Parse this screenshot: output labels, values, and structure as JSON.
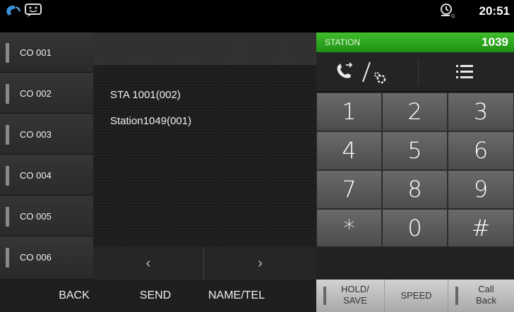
{
  "status_bar": {
    "time": "20:51",
    "icons": [
      "phone-icon",
      "chat-icon",
      "clock-settings-icon"
    ]
  },
  "co_lines": [
    {
      "label": "CO 001"
    },
    {
      "label": "CO 002"
    },
    {
      "label": "CO 003"
    },
    {
      "label": "CO 004"
    },
    {
      "label": "CO 005"
    },
    {
      "label": "CO 006"
    }
  ],
  "directory": {
    "entries": [
      "STA 1001(002)",
      "Station1049(001)"
    ],
    "prev_label": "‹",
    "next_label": "›"
  },
  "station": {
    "label": "STATION",
    "number": "1039",
    "accent_color": "#2aa31e"
  },
  "tools": {
    "left_icon": "call-forward-settings-icon",
    "right_icon": "list-icon"
  },
  "keypad": [
    "1",
    "2",
    "3",
    "4",
    "5",
    "6",
    "7",
    "8",
    "9",
    "*",
    "0",
    "#"
  ],
  "bottom_bar": {
    "back": "BACK",
    "send": "SEND",
    "name_tel": "NAME/TEL",
    "hold_save_line1": "HOLD/",
    "hold_save_line2": "SAVE",
    "speed": "SPEED",
    "call_back_line1": "Call",
    "call_back_line2": "Back"
  }
}
